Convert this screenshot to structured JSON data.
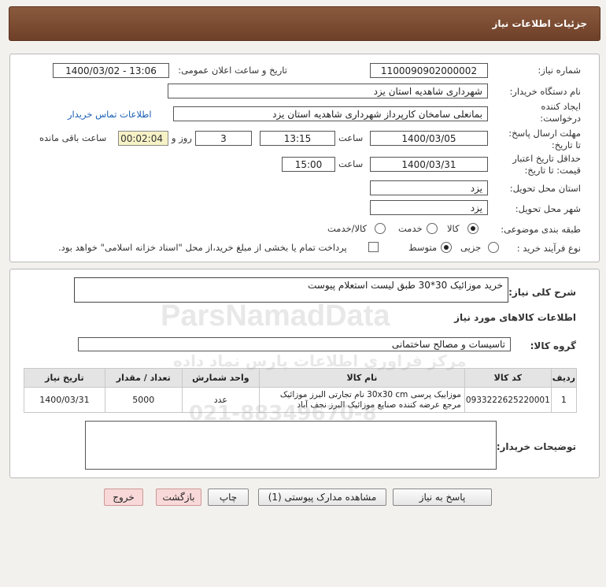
{
  "header": {
    "title": "جزئیات اطلاعات نیاز"
  },
  "fields": {
    "need_number_label": "شماره نیاز:",
    "need_number": "1100090902000002",
    "announce_label": "تاریخ و ساعت اعلان عمومی:",
    "announce_value": "1400/03/02 - 13:06",
    "buyer_org_label": "نام دستگاه خریدار:",
    "buyer_org": "شهرداری شاهدیه استان یزد",
    "creator_label_1": "ایجاد کننده",
    "creator_label_2": "درخواست:",
    "creator": "بمانعلی سامخان کارپرداز شهرداری شاهدیه استان یزد",
    "contact_link": "اطلاعات تماس خریدار",
    "deadline_label_1": "مهلت ارسال پاسخ:",
    "deadline_label_2": "تا تاریخ:",
    "deadline_date": "1400/03/05",
    "time_label": "ساعت",
    "deadline_time": "13:15",
    "days_count": "3",
    "days_label": "روز و",
    "remaining_time": "00:02:04",
    "remaining_label": "ساعت باقی مانده",
    "validity_label_1": "حداقل تاریخ اعتبار",
    "validity_label_2": "قیمت: تا تاریخ:",
    "validity_date": "1400/03/31",
    "validity_time_label": "ساعت",
    "validity_time": "15:00",
    "province_label": "استان محل تحویل:",
    "province": "یزد",
    "city_label": "شهر محل تحویل:",
    "city": "یزد",
    "category_label": "طبقه بندی موضوعی:",
    "category_options": [
      "کالا",
      "خدمت",
      "کالا/خدمت"
    ],
    "process_label": "نوع فرآیند خرید :",
    "process_options": [
      "جزیی",
      "متوسط"
    ],
    "payment_note": "پرداخت تمام یا بخشی از مبلغ خرید،از محل \"اسناد خزانه اسلامی\" خواهد بود."
  },
  "details": {
    "summary_label": "شرح کلی نیاز:",
    "summary": "خرید موزائیک 30*30 طبق لیست استعلام پیوست",
    "goods_info_title": "اطلاعات کالاهای مورد نیاز",
    "group_label": "گروه کالا:",
    "group_value": "تاسیسات و مصالح ساختمانی",
    "table": {
      "headers": [
        "ردیف",
        "کد کالا",
        "نام کالا",
        "واحد شمارش",
        "تعداد / مقدار",
        "تاریخ نیاز"
      ],
      "rows": [
        {
          "row": "1",
          "code": "0933222625220001",
          "name": "موزاییک پرسی 30x30 cm نام تجارتی البرز موزائیک مرجع عرضه کننده صنایع موزائیک البرز نجف آباد",
          "unit": "عدد",
          "qty": "5000",
          "date": "1400/03/31"
        }
      ]
    },
    "buyer_notes_label": "توضیحات خریدار:",
    "buyer_notes": ""
  },
  "buttons": {
    "reply": "پاسخ به نیاز",
    "attachments": "مشاهده مدارک پیوستی (1)",
    "print": "چاپ",
    "back": "بازگشت",
    "exit": "خروج"
  },
  "watermark": {
    "text": "ParsNamadData",
    "sub": "مرکز فراوری اطلاعات پارس نماد داده",
    "phone": "021-88349670-8"
  },
  "colors": {
    "header": "#7a4a30",
    "remaining_bg": "#f7f2c6",
    "exit_bg": "#f8d8d8"
  }
}
